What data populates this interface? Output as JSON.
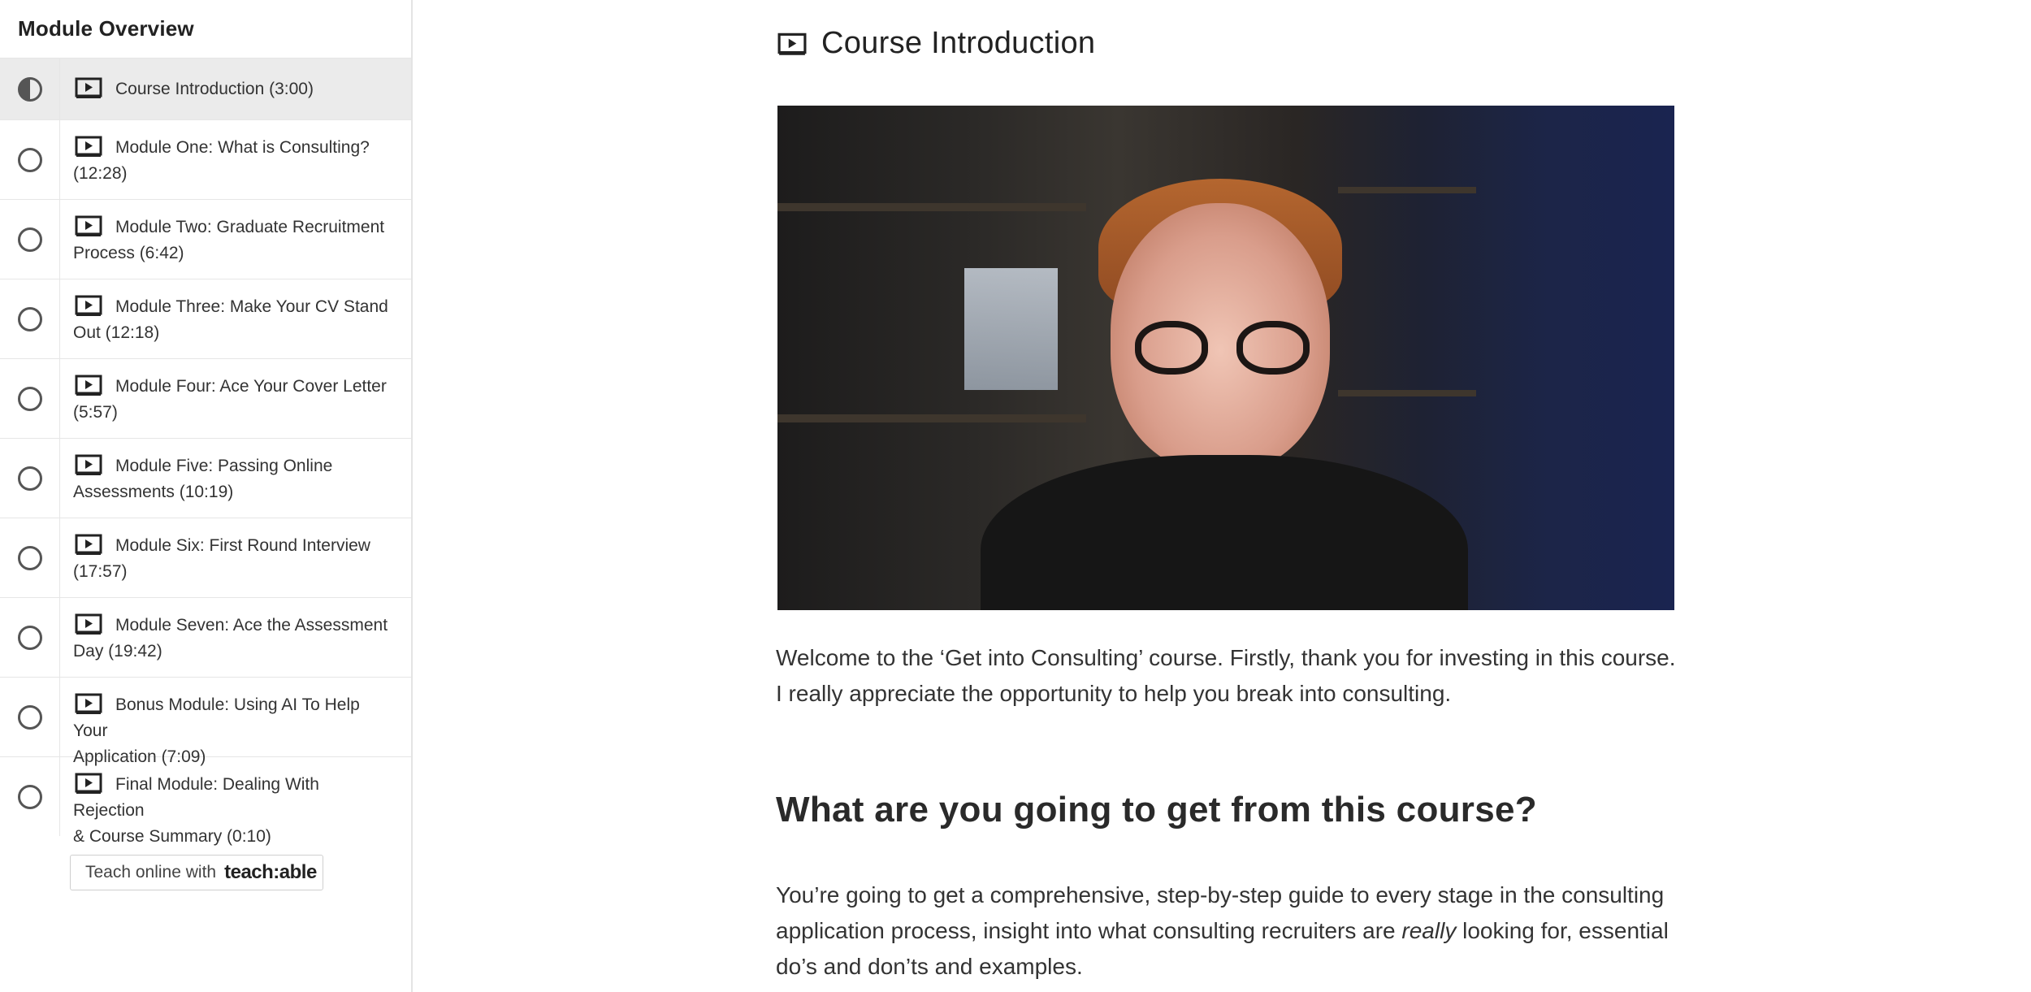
{
  "sidebar": {
    "header": "Module Overview",
    "lectures": [
      {
        "line1": "Course Introduction (3:00)",
        "line2": "",
        "status": "in-progress"
      },
      {
        "line1": "Module One: What is Consulting?",
        "line2": "(12:28)",
        "status": "incomplete"
      },
      {
        "line1": "Module Two: Graduate Recruitment",
        "line2": "Process (6:42)",
        "status": "incomplete"
      },
      {
        "line1": "Module Three: Make Your CV Stand",
        "line2": "Out (12:18)",
        "status": "incomplete"
      },
      {
        "line1": "Module Four: Ace Your Cover Letter",
        "line2": "(5:57)",
        "status": "incomplete"
      },
      {
        "line1": "Module Five: Passing Online",
        "line2": "Assessments (10:19)",
        "status": "incomplete"
      },
      {
        "line1": "Module Six: First Round Interview",
        "line2": "(17:57)",
        "status": "incomplete"
      },
      {
        "line1": "Module Seven: Ace the Assessment",
        "line2": "Day (19:42)",
        "status": "incomplete"
      },
      {
        "line1": "Bonus Module: Using AI To Help Your",
        "line2": "Application (7:09)",
        "status": "incomplete"
      },
      {
        "line1": "Final Module: Dealing With Rejection",
        "line2": "& Course Summary (0:10)",
        "status": "incomplete"
      }
    ],
    "teach_prefix": "Teach online with",
    "teach_brand": "teach:able"
  },
  "main": {
    "title": "Course Introduction",
    "intro_text": "Welcome to the ‘Get into Consulting’ course. Firstly, thank you for investing in this course. I really appreciate the opportunity to help you break into consulting.",
    "heading": "What are you going to get from this course?",
    "para_before": "You’re going to get a comprehensive, step-by-step guide to every stage in the consulting applica­tion process, insight into what consulting recruiters are ",
    "para_em": "really",
    "para_after": " looking for, essential do’s and don’ts and examples."
  },
  "icons": {
    "lecture": "video-play-icon"
  }
}
